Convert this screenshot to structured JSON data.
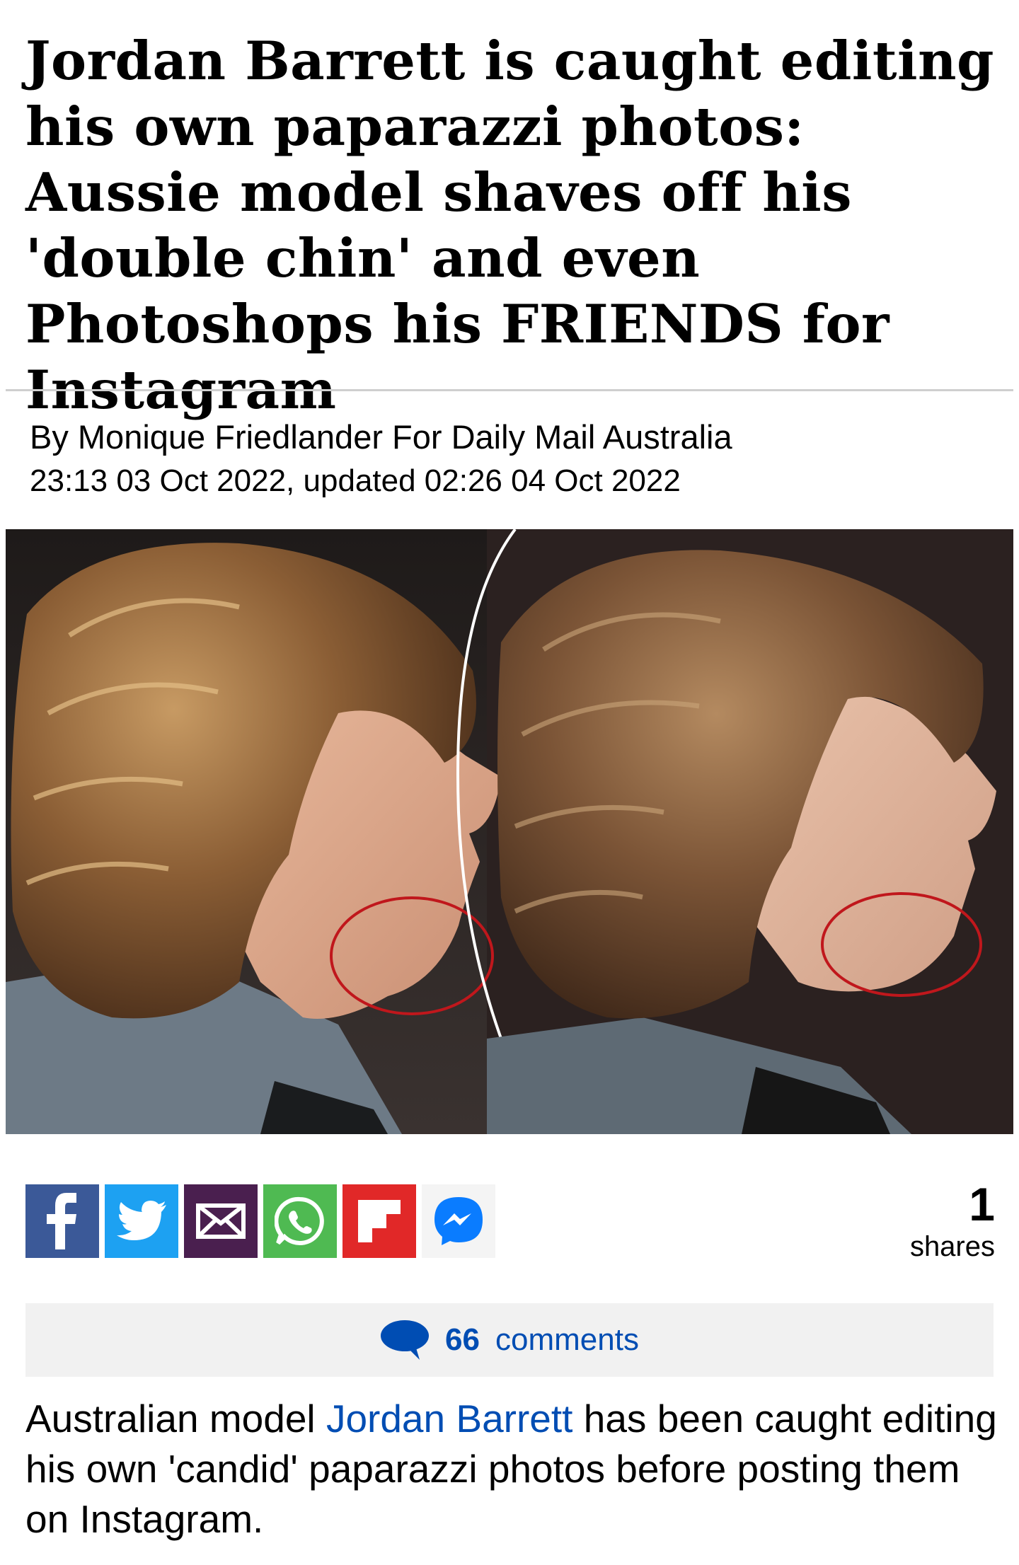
{
  "article": {
    "headline": "Jordan Barrett is caught editing his own paparazzi photos: Aussie model shaves off his 'double chin' and even Photoshops his FRIENDS for Instagram",
    "byline": "By Monique Friedlander For Daily Mail Australia",
    "dateline": "23:13 03 Oct 2022, updated 02:26 04 Oct 2022",
    "lead_before": "Australian model ",
    "lead_link": "Jordan Barrett",
    "lead_after": " has been caught editing his own 'candid' paparazzi photos before posting them on Instagram."
  },
  "share": {
    "count": "1",
    "label": "shares",
    "buttons": [
      {
        "name": "facebook",
        "icon": "facebook-icon",
        "color": "#3b5998"
      },
      {
        "name": "twitter",
        "icon": "twitter-icon",
        "color": "#1da1f2"
      },
      {
        "name": "email",
        "icon": "email-icon",
        "color": "#4a1f4f"
      },
      {
        "name": "whatsapp",
        "icon": "whatsapp-icon",
        "color": "#4fba52"
      },
      {
        "name": "flipboard",
        "icon": "flipboard-icon",
        "color": "#e12828"
      },
      {
        "name": "messenger",
        "icon": "messenger-icon",
        "color": "#0a7cff"
      }
    ]
  },
  "comments": {
    "count": "66",
    "label": "comments",
    "icon": "speech-bubble-icon"
  },
  "colors": {
    "link_blue": "#004db3",
    "rule_gray": "#cfcfcf",
    "comments_bg": "#f1f1f1",
    "highlight_red": "#c0171c"
  }
}
